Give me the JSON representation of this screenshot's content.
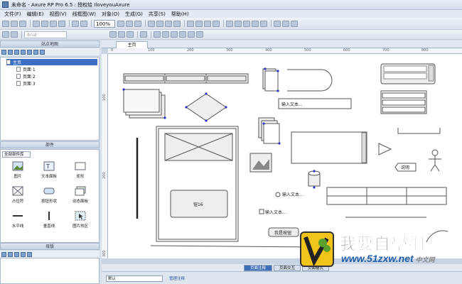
{
  "window": {
    "title": "未命名 - Axure RP Pro 6.5 : 授权给 IloveyouAxure"
  },
  "menu": [
    "文件(F)",
    "编辑(E)",
    "视图(V)",
    "线框图(W)",
    "对象(O)",
    "生成(G)",
    "共享(S)",
    "帮助(H)"
  ],
  "toolbar": {
    "zoom": "100%",
    "font_placeholder": "Arial"
  },
  "sitemap": {
    "title": "站点地图",
    "pages": [
      {
        "label": "主页",
        "selected": true
      },
      {
        "label": "页面 1"
      },
      {
        "label": "页面 2"
      },
      {
        "label": "页面 3"
      }
    ]
  },
  "widgets": {
    "title": "部件",
    "library": "全部部件库",
    "items": [
      {
        "label": "图片",
        "icon": "image-icon"
      },
      {
        "label": "文本面板",
        "icon": "text-panel-icon"
      },
      {
        "label": "矩形",
        "icon": "rectangle-icon"
      },
      {
        "label": "占位符",
        "icon": "placeholder-icon"
      },
      {
        "label": "按钮形状",
        "icon": "button-shape-icon"
      },
      {
        "label": "动态面板",
        "icon": "dynamic-panel-icon"
      },
      {
        "label": "水平线",
        "icon": "horizontal-line-icon"
      },
      {
        "label": "垂直线",
        "icon": "vertical-line-icon"
      },
      {
        "label": "图片热区",
        "icon": "hotspot-icon"
      }
    ]
  },
  "masters": {
    "title": "母版"
  },
  "editor": {
    "tab": "主页",
    "ruler_top": [
      "0",
      "100",
      "200",
      "300",
      "400",
      "500",
      "600",
      "700",
      "800"
    ],
    "ruler_left": [
      "100",
      "200",
      "300"
    ]
  },
  "canvas": {
    "text_input": "输入文本...",
    "radio_label": "输入文本...",
    "checkbox_label": "输入文本...",
    "button_label": "我是按钮",
    "big_button": "钮16",
    "small_tag": "说明"
  },
  "bottom": {
    "tabs": [
      "页面注释",
      "页面交互",
      "页面格式"
    ],
    "select": "默认",
    "link": "管理注释"
  },
  "watermark": {
    "brand": "我要自學網",
    "url": "www.51zxw.net",
    "suffix": "中文网"
  }
}
